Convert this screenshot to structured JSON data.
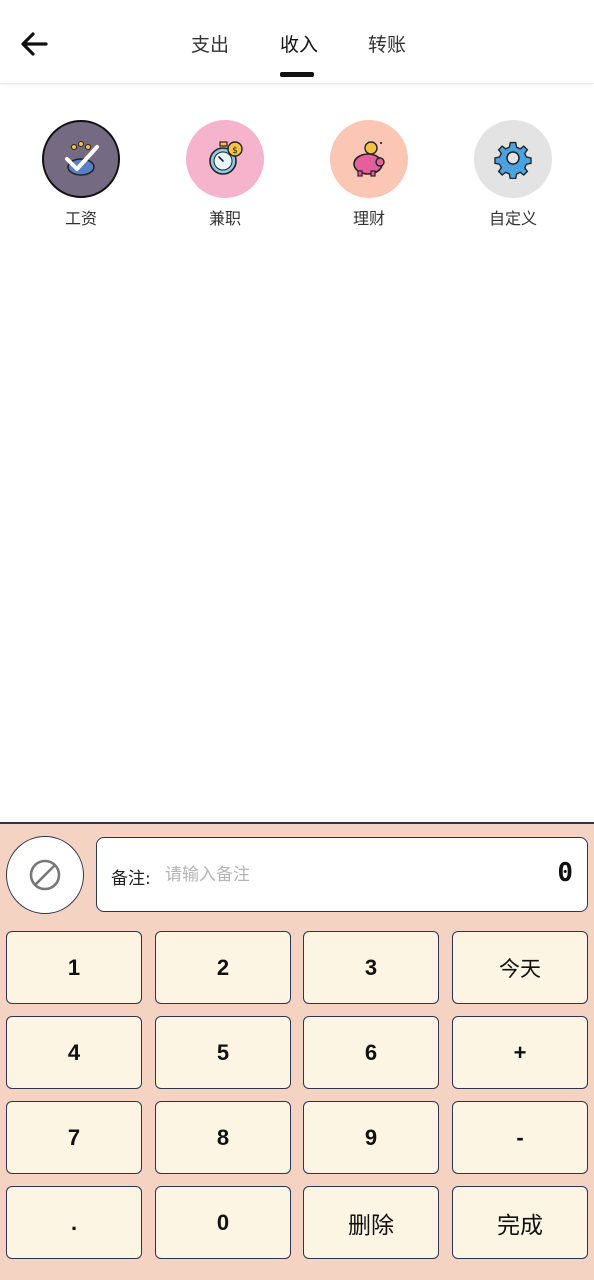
{
  "header": {
    "tabs": [
      {
        "label": "支出"
      },
      {
        "label": "收入"
      },
      {
        "label": "转账"
      }
    ],
    "active_tab": "收入"
  },
  "categories": [
    {
      "label": "工资",
      "icon": "salary-icon",
      "bg_color": "#746a82",
      "selected": true
    },
    {
      "label": "兼职",
      "icon": "stopwatch-icon",
      "bg_color": "#f6b3cc",
      "selected": false
    },
    {
      "label": "理财",
      "icon": "piggy-bank-icon",
      "bg_color": "#fcc6b4",
      "selected": false
    },
    {
      "label": "自定义",
      "icon": "gear-icon",
      "bg_color": "#e3e3e3",
      "selected": false
    }
  ],
  "entry": {
    "note_label": "备注:",
    "note_placeholder": "请输入备注",
    "note_value": "",
    "amount": "0"
  },
  "keypad": [
    [
      "1",
      "2",
      "3",
      "今天"
    ],
    [
      "4",
      "5",
      "6",
      "+"
    ],
    [
      "7",
      "8",
      "9",
      "-"
    ],
    [
      ".",
      "0",
      "删除",
      "完成"
    ]
  ],
  "colors": {
    "panel_bg": "#f5d3c3",
    "key_bg": "#fdf5e4",
    "border": "#2d3353"
  }
}
